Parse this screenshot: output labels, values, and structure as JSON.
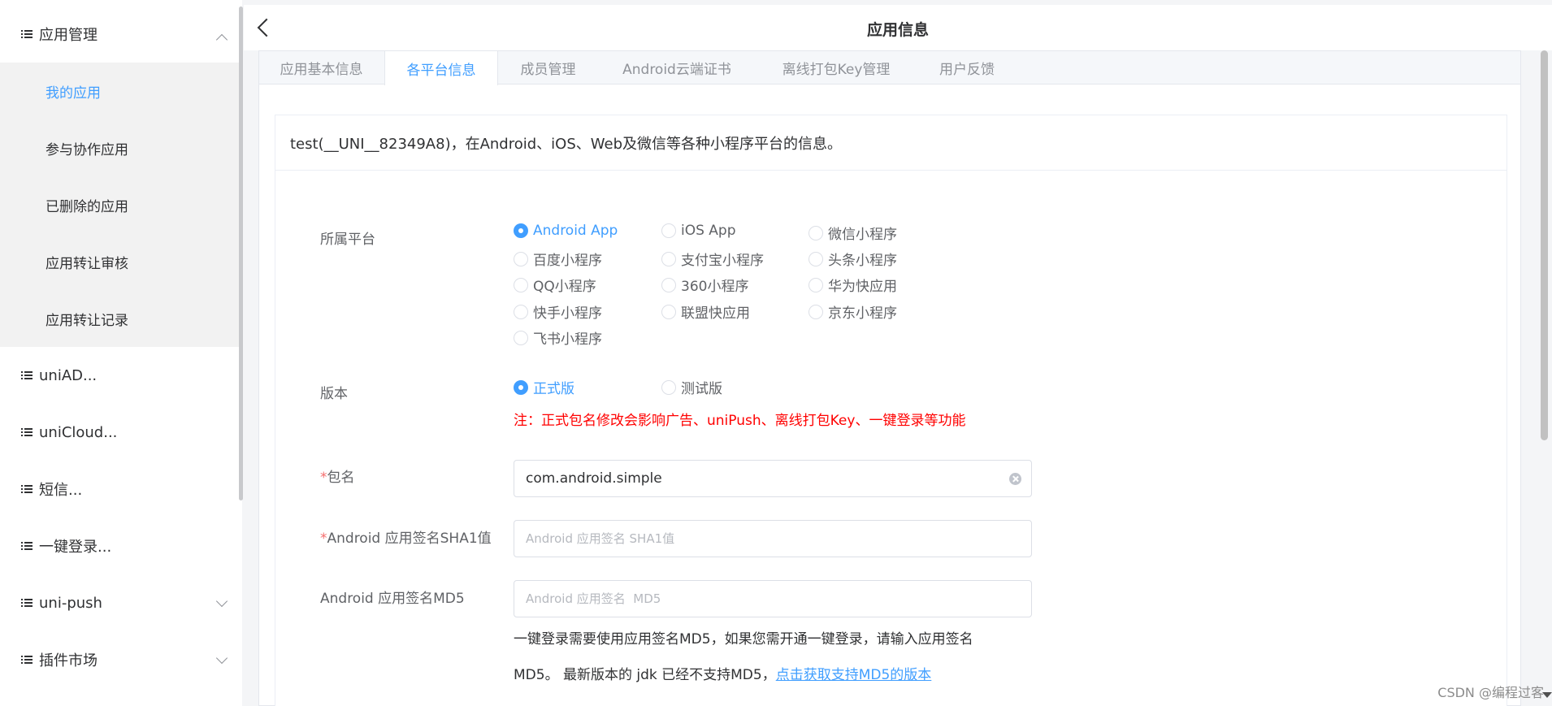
{
  "sidebar": {
    "group_app": "应用管理",
    "submenu": [
      "我的应用",
      "参与协作应用",
      "已删除的应用",
      "应用转让审核",
      "应用转让记录"
    ],
    "groups": [
      "uniAD...",
      "uniCloud...",
      "短信...",
      "一键登录...",
      "uni-push",
      "插件市场"
    ]
  },
  "header": {
    "title": "应用信息"
  },
  "tabs": [
    "应用基本信息",
    "各平台信息",
    "成员管理",
    "Android云端证书",
    "离线打包Key管理",
    "用户反馈"
  ],
  "card": {
    "heading": "test(__UNI__82349A8)，在Android、iOS、Web及微信等各种小程序平台的信息。"
  },
  "form": {
    "platform_label": "所属平台",
    "platforms": [
      "Android App",
      "iOS App",
      "微信小程序",
      "百度小程序",
      "支付宝小程序",
      "头条小程序",
      "QQ小程序",
      "360小程序",
      "华为快应用",
      "快手小程序",
      "联盟快应用",
      "京东小程序",
      "飞书小程序"
    ],
    "platform_selected": "Android App",
    "version_label": "版本",
    "versions": [
      "正式版",
      "测试版"
    ],
    "version_selected": "正式版",
    "version_warning": "注：正式包名修改会影响广告、uniPush、离线打包Key、一键登录等功能",
    "package_label": "包名",
    "required_mark": "*",
    "package_value": "com.android.simple",
    "sha1_label": "Android 应用签名SHA1值",
    "sha1_placeholder": "Android 应用签名 SHA1值",
    "md5_label": "Android 应用签名MD5",
    "md5_placeholder": "Android 应用签名  MD5",
    "md5_note_line1": "一键登录需要使用应用签名MD5，如果您需开通一键登录，请输入应用签名",
    "md5_note_line2": "MD5。 最新版本的 jdk 已经不支持MD5，",
    "md5_note_link": "点击获取支持MD5的版本"
  },
  "watermark": "CSDN @编程过客"
}
